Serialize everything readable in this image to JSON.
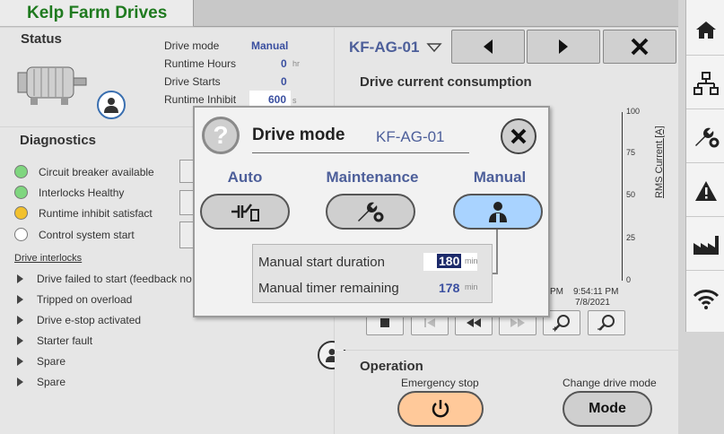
{
  "app": {
    "title": "Kelp Farm Drives"
  },
  "status": {
    "title": "Status",
    "fields": [
      {
        "label": "Drive mode",
        "value": "Manual",
        "unit": ""
      },
      {
        "label": "Runtime Hours",
        "value": "0",
        "unit": "hr"
      },
      {
        "label": "Drive Starts",
        "value": "0",
        "unit": ""
      },
      {
        "label": "Runtime Inhibit",
        "value": "600",
        "unit": "s"
      }
    ]
  },
  "diagnostics": {
    "title": "Diagnostics",
    "items": [
      {
        "label": "Circuit breaker available",
        "color": "#7fd67f"
      },
      {
        "label": "Interlocks Healthy",
        "color": "#7fd67f"
      },
      {
        "label": "Runtime inhibit satisfact",
        "color": "#f2c12e"
      },
      {
        "label": "Control system start",
        "color": "#ffffff"
      }
    ],
    "interlocks_title": "Drive interlocks",
    "interlocks": [
      "Drive failed to start (feedback no",
      "Tripped on overload",
      "Drive e-stop activated",
      "Starter fault",
      "Spare",
      "Spare"
    ]
  },
  "header": {
    "drive_id": "KF-AG-01"
  },
  "chart": {
    "title": "Drive current consumption",
    "ylabel": "RMS Current [A]",
    "yticks": [
      "100",
      "75",
      "50",
      "25",
      "0"
    ],
    "xticks": [
      "PM",
      "9:54:11 PM",
      "7/8/2021"
    ]
  },
  "operation": {
    "title": "Operation",
    "estop_label": "Emergency stop",
    "change_mode_label": "Change drive mode",
    "mode_button": "Mode"
  },
  "dialog": {
    "title": "Drive mode",
    "drive_id": "KF-AG-01",
    "modes": [
      {
        "label": "Auto",
        "selected": false
      },
      {
        "label": "Maintenance",
        "selected": false
      },
      {
        "label": "Manual",
        "selected": true
      }
    ],
    "manual_start_duration_label": "Manual start duration",
    "manual_start_duration": "180",
    "manual_start_unit": "min",
    "manual_timer_label": "Manual timer remaining",
    "manual_timer_value": "178",
    "manual_timer_unit": "min"
  },
  "colors": {
    "accent_blue": "#4d5f9a",
    "selected_mode": "#a9d3ff",
    "estop": "#ffc99a",
    "title_green": "#1f7a1f"
  }
}
